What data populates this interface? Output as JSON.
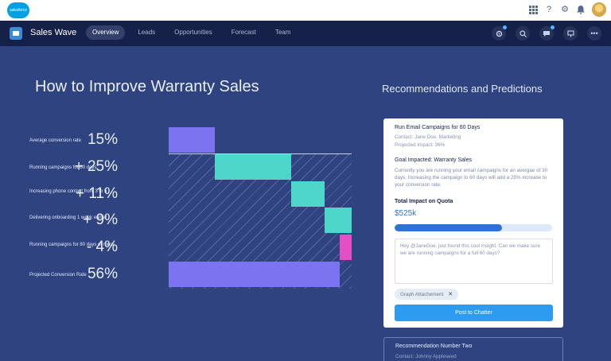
{
  "global_header": {
    "logo_text": "salesforce",
    "icons": [
      "apps-grid-icon",
      "help-icon",
      "gear-icon",
      "bell-icon",
      "avatar"
    ]
  },
  "app_nav": {
    "app_name": "Sales Wave",
    "tabs": [
      {
        "label": "Overview",
        "active": true
      },
      {
        "label": "Leads",
        "active": false
      },
      {
        "label": "Opportunities",
        "active": false
      },
      {
        "label": "Forecast",
        "active": false
      },
      {
        "label": "Team",
        "active": false
      }
    ],
    "right_icons": [
      "settings-icon",
      "search-icon",
      "chat-icon",
      "chatter-icon",
      "more-icon"
    ]
  },
  "page": {
    "title": "How to Improve Warranty Sales"
  },
  "chart_data": {
    "type": "bar",
    "categories": [
      "Average conversion rate",
      "Running campaigns for 60 days",
      "Increasing phone contact from 3 to 5",
      "Delivering onboarding 1 week earlier",
      "Running campaigns for 80 days or more",
      "Projected Conversion Rate"
    ],
    "value_labels": [
      "15%",
      "+ 25%",
      "+ 11%",
      "+ 9%",
      "- 4%",
      "56%"
    ],
    "values": [
      15,
      25,
      11,
      9,
      -4,
      56
    ],
    "colors": [
      "#7b73f0",
      "#4fd6cb",
      "#4fd6cb",
      "#4fd6cb",
      "#e64ec6",
      "#7b73f0"
    ]
  },
  "recommendations": {
    "title": "Recommendations and Predictions",
    "card1": {
      "title": "Run Email Campaigns for 60 Days",
      "contact": "Contact: Jane Doe, Marketing",
      "projected_impact": "Projected Impact: 36%",
      "goal": "Goal Impacted: Warranty Sales",
      "description": "Currently you are running your email campaigns for an avergae of 30 days. Increasing the campaign to 60 days will add a 25% increase to your conversion rate.",
      "impact_label": "Total Impact on Quota",
      "impact_value": "$525k",
      "impact_progress": 0.68,
      "message": "Hey @JaneDoe, just found this cool insight. Can we make sure we are running campaigns for a full 60 days?",
      "attachment": "Graph Attachement",
      "post_button": "Post to Chatter"
    },
    "card2": {
      "title": "Recommendation Number Two",
      "contact": "Contact: Johnny Appleseed"
    }
  }
}
